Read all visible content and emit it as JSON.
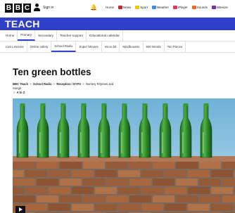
{
  "header": {
    "logo_letters": [
      "B",
      "B",
      "C"
    ],
    "signin_label": "Sign in",
    "nav": [
      {
        "label": "Home",
        "color": ""
      },
      {
        "label": "News",
        "color": "#c62a2a"
      },
      {
        "label": "Sport",
        "color": "#f2c300"
      },
      {
        "label": "Weather",
        "color": "#3a8de0"
      },
      {
        "label": "iPlayer",
        "color": "#e5325a"
      },
      {
        "label": "Sounds",
        "color": "#f26a1b"
      },
      {
        "label": "Bitesize",
        "color": "#7b2ca8"
      }
    ]
  },
  "brand": {
    "title": "TEACH",
    "color": "#2f3fc7"
  },
  "subnav": {
    "items": [
      "Home",
      "Primary",
      "Secondary",
      "Teacher support",
      "Educational calendar"
    ],
    "active_index": 1
  },
  "subnav2": {
    "items": [
      "Live Lessons",
      "Online safety",
      "School Radio",
      "Super Movers",
      "micro:bit",
      "Mindbooster",
      "500 Words",
      "Ten Pieces"
    ],
    "active_index": 2
  },
  "page": {
    "title": "Ten green bottles",
    "breadcrumb": [
      "BBC Teach",
      "School Radio",
      "Reception / EYFS",
      "Nursery Rhymes and Songs",
      "A to Z"
    ],
    "breadcrumb_sep": ">"
  },
  "hero": {
    "bottle_count": 10,
    "bottle_color": "#2f8f2a",
    "wall_color": "#9b5d3a",
    "sky_color": "#8ec2de"
  }
}
